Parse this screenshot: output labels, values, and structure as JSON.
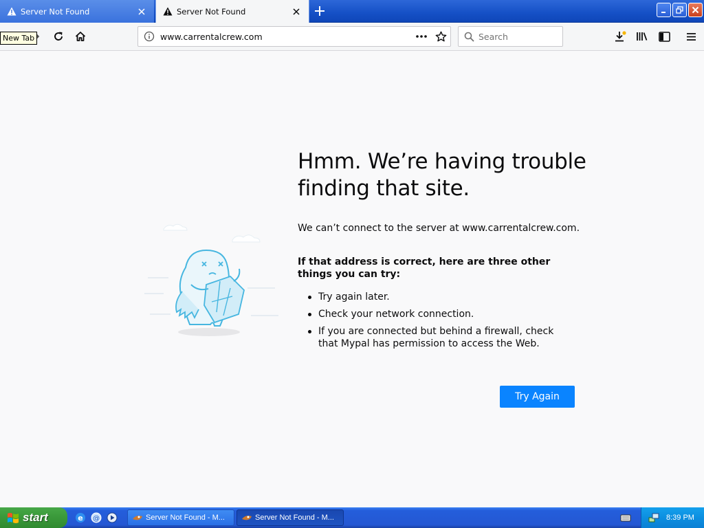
{
  "tabs": [
    {
      "title": "Server Not Found",
      "active": false
    },
    {
      "title": "Server Not Found",
      "active": true
    }
  ],
  "tooltip": "New Tab",
  "urlbar": {
    "url": "www.carrentalcrew.com"
  },
  "searchbar": {
    "placeholder": "Search"
  },
  "error": {
    "title": "Hmm. We’re having trouble finding that site.",
    "description": "We can’t connect to the server at www.carrentalcrew.com.",
    "subtitle": "If that address is correct, here are three other things you can try:",
    "suggestions": [
      "Try again later.",
      "Check your network connection.",
      "If you are connected but behind a firewall, check that Mypal has permission to access the Web."
    ],
    "button_label": "Try Again"
  },
  "taskbar": {
    "start_label": "start",
    "tasks": [
      {
        "label": "Server Not Found - M...",
        "pressed": false
      },
      {
        "label": "Server Not Found - M...",
        "pressed": true
      }
    ],
    "clock": "8:39 PM"
  },
  "colors": {
    "accent": "#0a84ff",
    "titlebar": "#1550c6",
    "page_bg": "#f9f9fa",
    "illustration": "#46b6e0"
  },
  "icons": [
    "warning-icon",
    "close-icon",
    "plus-icon",
    "minimize-icon",
    "maximize-icon",
    "window-close-icon",
    "forward-icon",
    "reload-icon",
    "home-icon",
    "info-icon",
    "more-icon",
    "star-icon",
    "search-icon",
    "download-icon",
    "library-icon",
    "sidebar-icon",
    "menu-icon"
  ]
}
